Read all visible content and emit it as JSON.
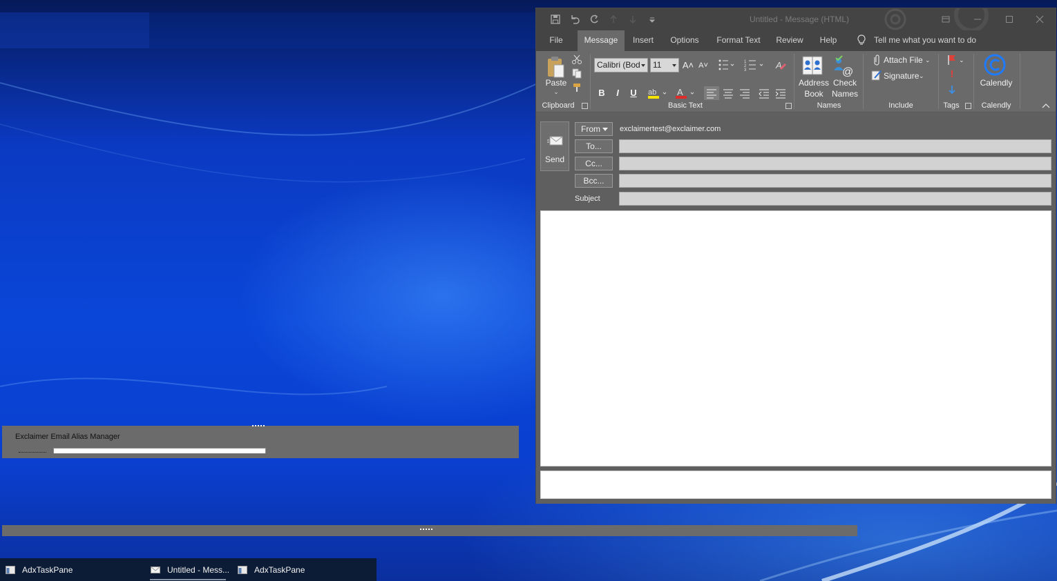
{
  "outlook": {
    "title": "Untitled  -  Message (HTML)",
    "tabs": [
      "File",
      "Message",
      "Insert",
      "Options",
      "Format Text",
      "Review",
      "Help"
    ],
    "active_tab": "Message",
    "tell_me": "Tell me what you want to do",
    "ribbon": {
      "clipboard": {
        "paste": "Paste",
        "group": "Clipboard"
      },
      "basic_text": {
        "font": "Calibri (Bod",
        "size": "11",
        "bold": "B",
        "italic": "I",
        "underline": "U",
        "group": "Basic Text"
      },
      "names": {
        "address_line1": "Address",
        "address_line2": "Book",
        "check_line1": "Check",
        "check_line2": "Names",
        "group": "Names"
      },
      "include": {
        "attach": "Attach File",
        "signature": "Signature",
        "group": "Include"
      },
      "tags": {
        "group": "Tags"
      },
      "calendly": {
        "label": "Calendly",
        "group": "Calendly"
      }
    },
    "compose": {
      "send": "Send",
      "from_btn": "From",
      "from_email": "exclaimertest@exclaimer.com",
      "to_btn": "To...",
      "cc_btn": "Cc...",
      "bcc_btn": "Bcc...",
      "subject_label": "Subject"
    }
  },
  "exclaimer_pane": {
    "title": "Exclaimer Email Alias Manager"
  },
  "taskbar": {
    "items": [
      "AdxTaskPane",
      "Untitled - Mess...",
      "AdxTaskPane"
    ]
  },
  "colors": {
    "desktop_blue": "#0a46d8",
    "window_dark": "#444444",
    "ribbon_gray": "#6a6a6a",
    "calendly_blue": "#1e7bff",
    "flag_red": "#e0403a"
  },
  "icons": [
    "save-icon",
    "undo-icon",
    "redo-icon",
    "paste-icon",
    "cut-icon",
    "copy-icon",
    "format-painter-icon",
    "address-book-icon",
    "check-names-icon",
    "attach-icon",
    "signature-icon",
    "flag-icon",
    "high-importance-icon",
    "low-importance-icon",
    "calendly-icon",
    "send-icon",
    "lightbulb-icon"
  ]
}
